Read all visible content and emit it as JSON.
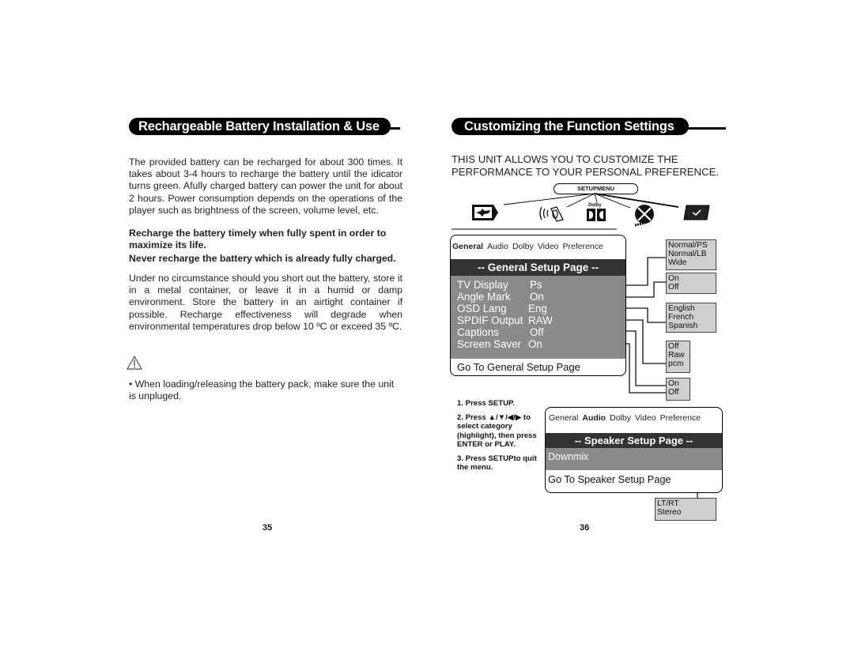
{
  "left_page": {
    "title": "Rechargeable Battery Installation & Use",
    "paragraph_1": "The provided battery can be recharged for about 300 times. It takes about 3-4 hours to recharge the battery until the idicator turns green. Afully charged battery can power the unit for about 2 hours. Power consumption depends on the operations of the player such as brightness of the screen, volume level, etc.",
    "bold_1": "Recharge the battery timely when fully spent in order to maximize its life.",
    "bold_2": "Never recharge the battery which is already fully charged.",
    "paragraph_2": "Under no circumstance should you short out the battery, store it in a metal container, or leave it in a humid or damp environment. Store the battery in an airtight container if possible. Recharge effectiveness will degrade when environmental temperatures drop below 10 ºC or exceed 35 ºC.",
    "warning_icon": "warning-triangle-icon",
    "note": "• When loading/releasing the battery pack, make sure the unit is unpluged.",
    "page_number": "35"
  },
  "right_page": {
    "title": "Customizing the Function Settings",
    "intro_line_1": "THIS UNIT ALLOWS YOU TO CUSTOMIZE THE",
    "intro_line_2": "PERFORMANCE TO YOUR PERSONAL PREFERENCE.",
    "setup_menu_label": "SETUPMENU",
    "category_icons": [
      "general-monitor-icon",
      "audio-speaker-icon",
      "dolby-icon",
      "video-reel-icon",
      "preference-check-icon"
    ],
    "dolby_label": "Dolby",
    "general_menu": {
      "tabs": [
        "General",
        "Audio",
        "Dolby",
        "Video",
        "Preference"
      ],
      "selected_tab": "General",
      "header": "-- General Setup Page --",
      "items": [
        {
          "label": "TV Display",
          "value": "Ps"
        },
        {
          "label": "Angle Mark",
          "value": "On"
        },
        {
          "label": "OSD Lang",
          "value": "Eng"
        },
        {
          "label": "SPDIF Output",
          "value": "RAW"
        },
        {
          "label": "Captions",
          "value": "Off"
        },
        {
          "label": "Screen Saver",
          "value": "On"
        }
      ],
      "footer": "Go To General Setup Page"
    },
    "general_options": [
      [
        "Normal/PS",
        "Normal/LB",
        "Wide"
      ],
      [
        "On",
        "Off"
      ],
      [
        "English",
        "French",
        "Spanish"
      ],
      [
        "Off",
        "Raw",
        "pcm"
      ],
      [
        "On",
        "Off"
      ]
    ],
    "steps": [
      "1. Press SETUP.",
      "2. Press ▲/▼/◀/▶ to select category (highlight), then press ENTER or PLAY.",
      "3. Press SETUPto quit the menu."
    ],
    "speaker_menu": {
      "tabs": [
        "General",
        "Audio",
        "Dolby",
        "Video",
        "Preference"
      ],
      "selected_tab": "Audio",
      "header": "-- Speaker Setup Page --",
      "items": [
        {
          "label": "Downmix"
        }
      ],
      "footer": "Go To Speaker Setup Page"
    },
    "speaker_options": [
      "LT/RT",
      "Stereo"
    ],
    "page_number": "36"
  }
}
